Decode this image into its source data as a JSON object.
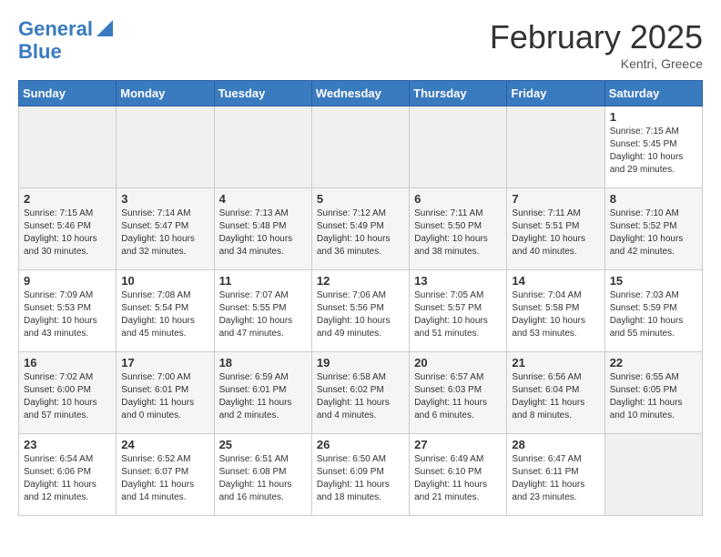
{
  "header": {
    "logo_line1": "General",
    "logo_line2": "Blue",
    "title": "February 2025",
    "subtitle": "Kentri, Greece"
  },
  "days_of_week": [
    "Sunday",
    "Monday",
    "Tuesday",
    "Wednesday",
    "Thursday",
    "Friday",
    "Saturday"
  ],
  "weeks": [
    [
      {
        "day": "",
        "info": ""
      },
      {
        "day": "",
        "info": ""
      },
      {
        "day": "",
        "info": ""
      },
      {
        "day": "",
        "info": ""
      },
      {
        "day": "",
        "info": ""
      },
      {
        "day": "",
        "info": ""
      },
      {
        "day": "1",
        "info": "Sunrise: 7:15 AM\nSunset: 5:45 PM\nDaylight: 10 hours and 29 minutes."
      }
    ],
    [
      {
        "day": "2",
        "info": "Sunrise: 7:15 AM\nSunset: 5:46 PM\nDaylight: 10 hours and 30 minutes."
      },
      {
        "day": "3",
        "info": "Sunrise: 7:14 AM\nSunset: 5:47 PM\nDaylight: 10 hours and 32 minutes."
      },
      {
        "day": "4",
        "info": "Sunrise: 7:13 AM\nSunset: 5:48 PM\nDaylight: 10 hours and 34 minutes."
      },
      {
        "day": "5",
        "info": "Sunrise: 7:12 AM\nSunset: 5:49 PM\nDaylight: 10 hours and 36 minutes."
      },
      {
        "day": "6",
        "info": "Sunrise: 7:11 AM\nSunset: 5:50 PM\nDaylight: 10 hours and 38 minutes."
      },
      {
        "day": "7",
        "info": "Sunrise: 7:11 AM\nSunset: 5:51 PM\nDaylight: 10 hours and 40 minutes."
      },
      {
        "day": "8",
        "info": "Sunrise: 7:10 AM\nSunset: 5:52 PM\nDaylight: 10 hours and 42 minutes."
      }
    ],
    [
      {
        "day": "9",
        "info": "Sunrise: 7:09 AM\nSunset: 5:53 PM\nDaylight: 10 hours and 43 minutes."
      },
      {
        "day": "10",
        "info": "Sunrise: 7:08 AM\nSunset: 5:54 PM\nDaylight: 10 hours and 45 minutes."
      },
      {
        "day": "11",
        "info": "Sunrise: 7:07 AM\nSunset: 5:55 PM\nDaylight: 10 hours and 47 minutes."
      },
      {
        "day": "12",
        "info": "Sunrise: 7:06 AM\nSunset: 5:56 PM\nDaylight: 10 hours and 49 minutes."
      },
      {
        "day": "13",
        "info": "Sunrise: 7:05 AM\nSunset: 5:57 PM\nDaylight: 10 hours and 51 minutes."
      },
      {
        "day": "14",
        "info": "Sunrise: 7:04 AM\nSunset: 5:58 PM\nDaylight: 10 hours and 53 minutes."
      },
      {
        "day": "15",
        "info": "Sunrise: 7:03 AM\nSunset: 5:59 PM\nDaylight: 10 hours and 55 minutes."
      }
    ],
    [
      {
        "day": "16",
        "info": "Sunrise: 7:02 AM\nSunset: 6:00 PM\nDaylight: 10 hours and 57 minutes."
      },
      {
        "day": "17",
        "info": "Sunrise: 7:00 AM\nSunset: 6:01 PM\nDaylight: 11 hours and 0 minutes."
      },
      {
        "day": "18",
        "info": "Sunrise: 6:59 AM\nSunset: 6:01 PM\nDaylight: 11 hours and 2 minutes."
      },
      {
        "day": "19",
        "info": "Sunrise: 6:58 AM\nSunset: 6:02 PM\nDaylight: 11 hours and 4 minutes."
      },
      {
        "day": "20",
        "info": "Sunrise: 6:57 AM\nSunset: 6:03 PM\nDaylight: 11 hours and 6 minutes."
      },
      {
        "day": "21",
        "info": "Sunrise: 6:56 AM\nSunset: 6:04 PM\nDaylight: 11 hours and 8 minutes."
      },
      {
        "day": "22",
        "info": "Sunrise: 6:55 AM\nSunset: 6:05 PM\nDaylight: 11 hours and 10 minutes."
      }
    ],
    [
      {
        "day": "23",
        "info": "Sunrise: 6:54 AM\nSunset: 6:06 PM\nDaylight: 11 hours and 12 minutes."
      },
      {
        "day": "24",
        "info": "Sunrise: 6:52 AM\nSunset: 6:07 PM\nDaylight: 11 hours and 14 minutes."
      },
      {
        "day": "25",
        "info": "Sunrise: 6:51 AM\nSunset: 6:08 PM\nDaylight: 11 hours and 16 minutes."
      },
      {
        "day": "26",
        "info": "Sunrise: 6:50 AM\nSunset: 6:09 PM\nDaylight: 11 hours and 18 minutes."
      },
      {
        "day": "27",
        "info": "Sunrise: 6:49 AM\nSunset: 6:10 PM\nDaylight: 11 hours and 21 minutes."
      },
      {
        "day": "28",
        "info": "Sunrise: 6:47 AM\nSunset: 6:11 PM\nDaylight: 11 hours and 23 minutes."
      },
      {
        "day": "",
        "info": ""
      }
    ]
  ]
}
